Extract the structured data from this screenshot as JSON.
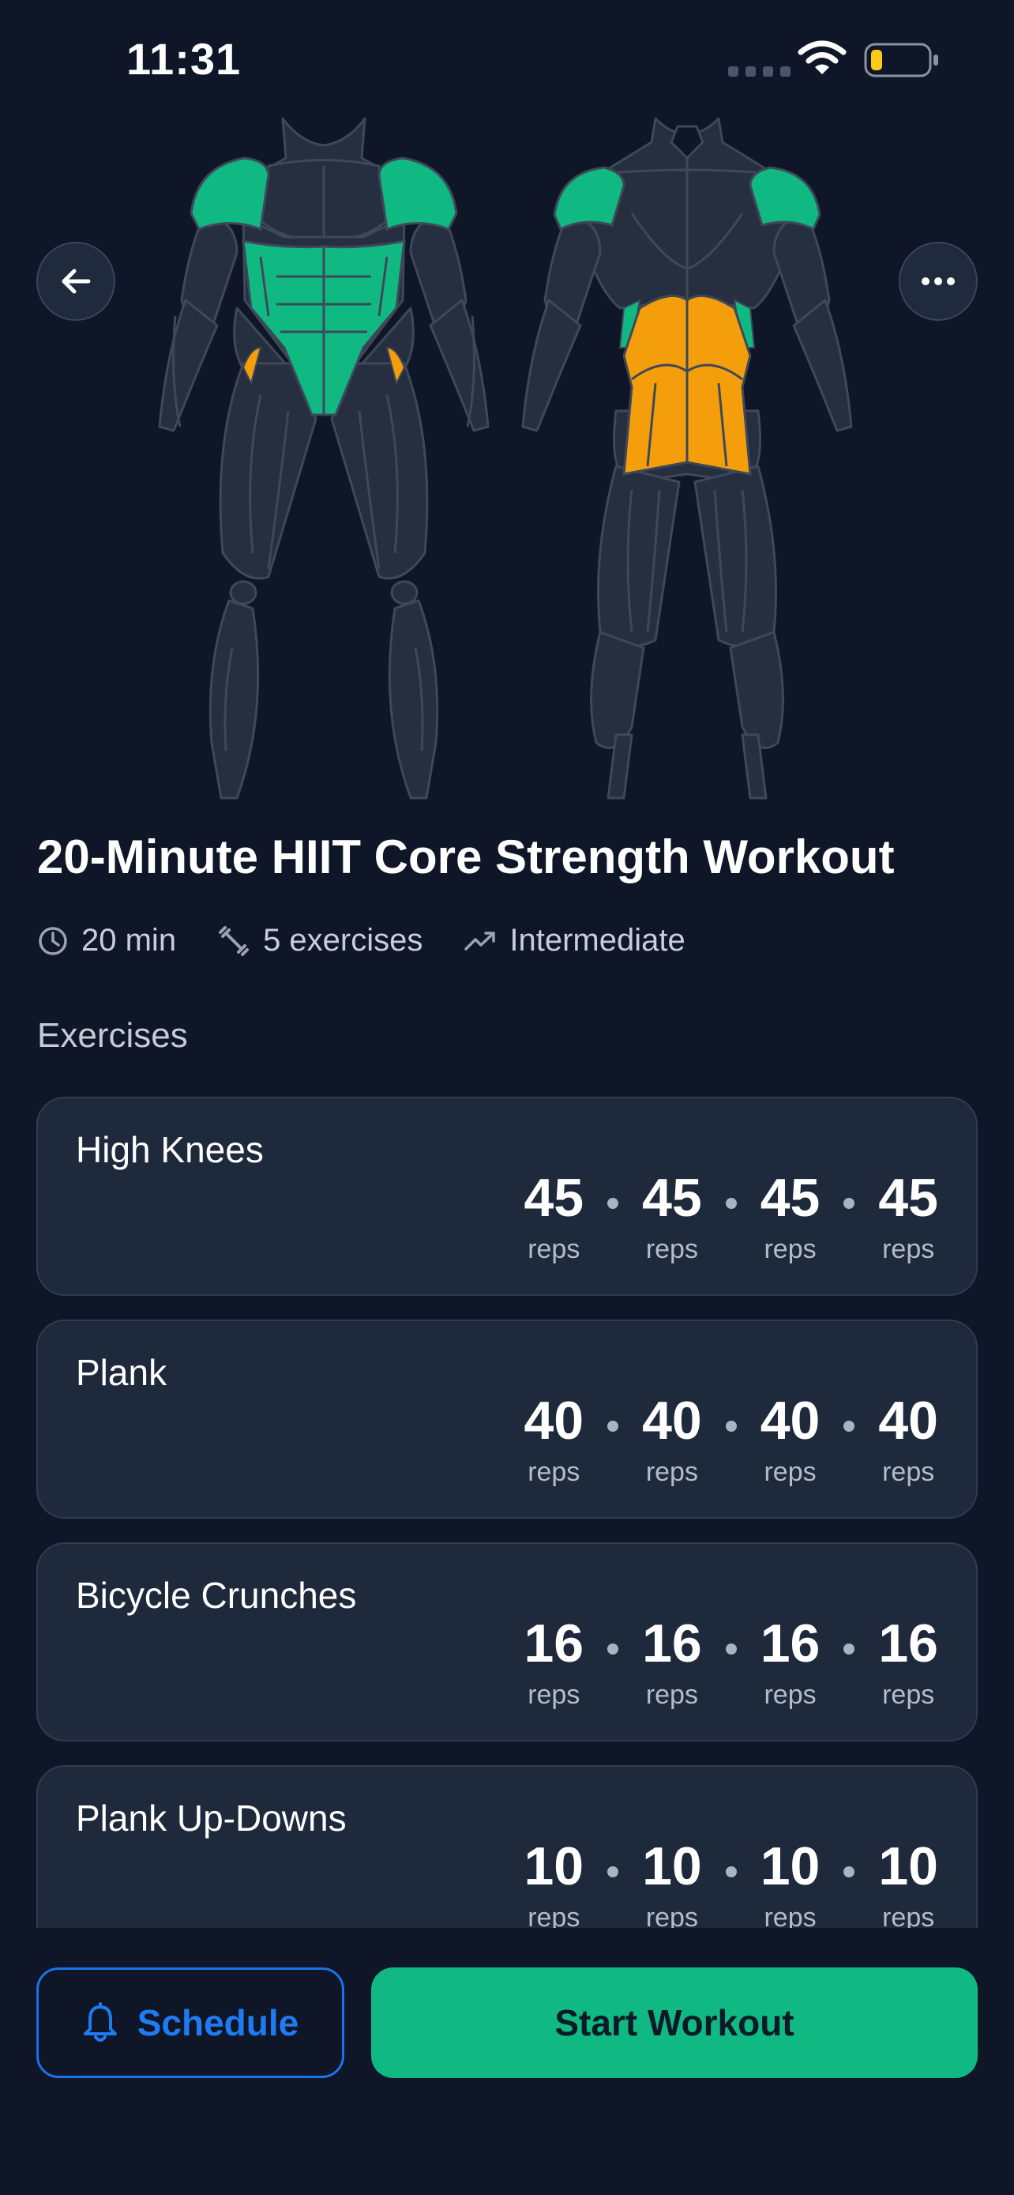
{
  "status_bar": {
    "time": "11:31",
    "icons": [
      "signal-icon",
      "wifi-icon",
      "battery-low-icon"
    ],
    "battery_color": "#facc15"
  },
  "header": {
    "back_icon": "arrow-left-icon",
    "more_icon": "more-horizontal-icon"
  },
  "muscle_map": {
    "primary_color": "#10b981",
    "secondary_color": "#f59e0b",
    "base_color": "#262f3f",
    "views": [
      "front",
      "back"
    ]
  },
  "workout": {
    "title": "20-Minute HIIT Core Strength Workout",
    "duration": "20 min",
    "exercise_count": "5 exercises",
    "level": "Intermediate"
  },
  "exercises_section": {
    "label": "Exercises"
  },
  "exercises": [
    {
      "name": "High Knees",
      "sets": [
        {
          "value": "45",
          "unit": "reps"
        },
        {
          "value": "45",
          "unit": "reps"
        },
        {
          "value": "45",
          "unit": "reps"
        },
        {
          "value": "45",
          "unit": "reps"
        }
      ]
    },
    {
      "name": "Plank",
      "sets": [
        {
          "value": "40",
          "unit": "reps"
        },
        {
          "value": "40",
          "unit": "reps"
        },
        {
          "value": "40",
          "unit": "reps"
        },
        {
          "value": "40",
          "unit": "reps"
        }
      ]
    },
    {
      "name": "Bicycle Crunches",
      "sets": [
        {
          "value": "16",
          "unit": "reps"
        },
        {
          "value": "16",
          "unit": "reps"
        },
        {
          "value": "16",
          "unit": "reps"
        },
        {
          "value": "16",
          "unit": "reps"
        }
      ]
    },
    {
      "name": "Plank Up-Downs",
      "sets": [
        {
          "value": "10",
          "unit": "reps"
        },
        {
          "value": "10",
          "unit": "reps"
        },
        {
          "value": "10",
          "unit": "reps"
        },
        {
          "value": "10",
          "unit": "reps"
        }
      ]
    }
  ],
  "actions": {
    "schedule_label": "Schedule",
    "start_label": "Start Workout",
    "accent_blue": "#1a73e8",
    "accent_green": "#10b981"
  }
}
